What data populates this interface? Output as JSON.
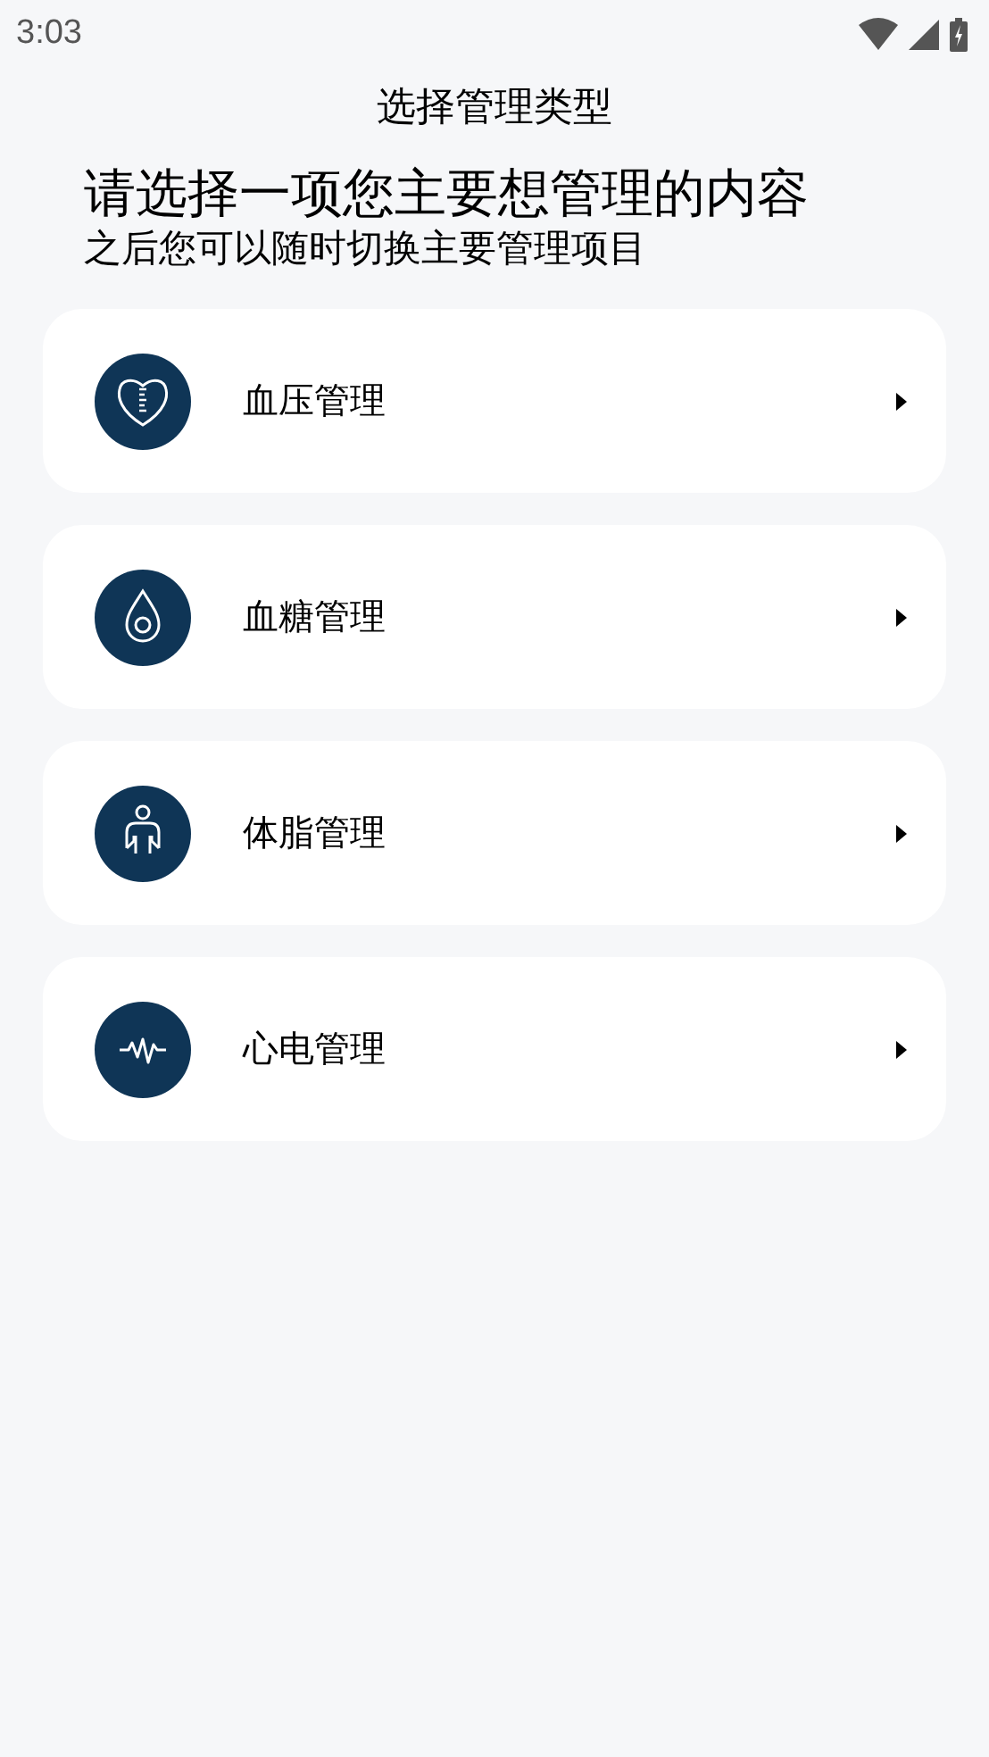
{
  "status_bar": {
    "time": "3:03"
  },
  "title": "选择管理类型",
  "heading": "请选择一项您主要想管理的内容",
  "subheading": "之后您可以随时切换主要管理项目",
  "options": [
    {
      "kind": "heart",
      "label": "血压管理"
    },
    {
      "kind": "drop",
      "label": "血糖管理"
    },
    {
      "kind": "body",
      "label": "体脂管理"
    },
    {
      "kind": "pulse",
      "label": "心电管理"
    }
  ]
}
